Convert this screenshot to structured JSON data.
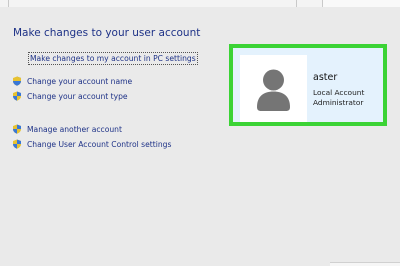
{
  "header": {
    "title": "Make changes to your user account"
  },
  "links": {
    "pc_settings": "Make changes to my account in PC settings",
    "change_name": "Change your account name",
    "change_type": "Change your account type",
    "manage_another": "Manage another account",
    "uac_settings": "Change User Account Control settings"
  },
  "user": {
    "name": "aster",
    "account_type": "Local Account",
    "role": "Administrator"
  },
  "colors": {
    "link": "#1e3287",
    "highlight": "#3bd335",
    "card_bg": "#e4f2fd",
    "page_bg": "#eaeaea"
  },
  "icons": {
    "shield": "uac-shield-icon",
    "avatar": "user-avatar-icon"
  }
}
